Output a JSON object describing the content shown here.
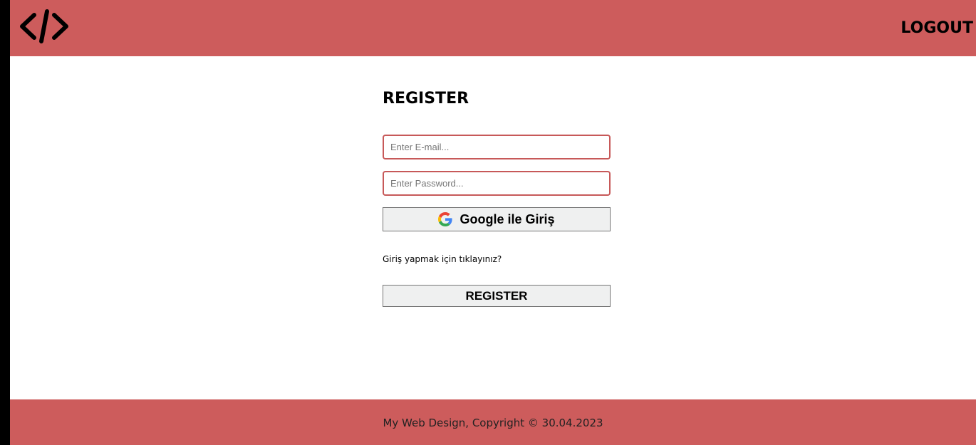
{
  "colors": {
    "header_bg": "#cd5c5c",
    "footer_bg": "#cd5c5c",
    "input_border": "#c75959",
    "button_bg": "#eff0f0"
  },
  "header": {
    "logo_icon": "code-brackets-icon",
    "logout_label": "LOGOUT"
  },
  "form": {
    "title": "REGISTER",
    "email": {
      "placeholder": "Enter E-mail...",
      "value": ""
    },
    "password": {
      "placeholder": "Enter Password...",
      "value": ""
    },
    "google_button": {
      "icon": "google-icon",
      "label": "Google ile Giriş"
    },
    "login_link": "Giriş yapmak için tıklayınız?",
    "register_button": "REGISTER"
  },
  "footer": {
    "text": "My Web Design, Copyright © 30.04.2023"
  }
}
